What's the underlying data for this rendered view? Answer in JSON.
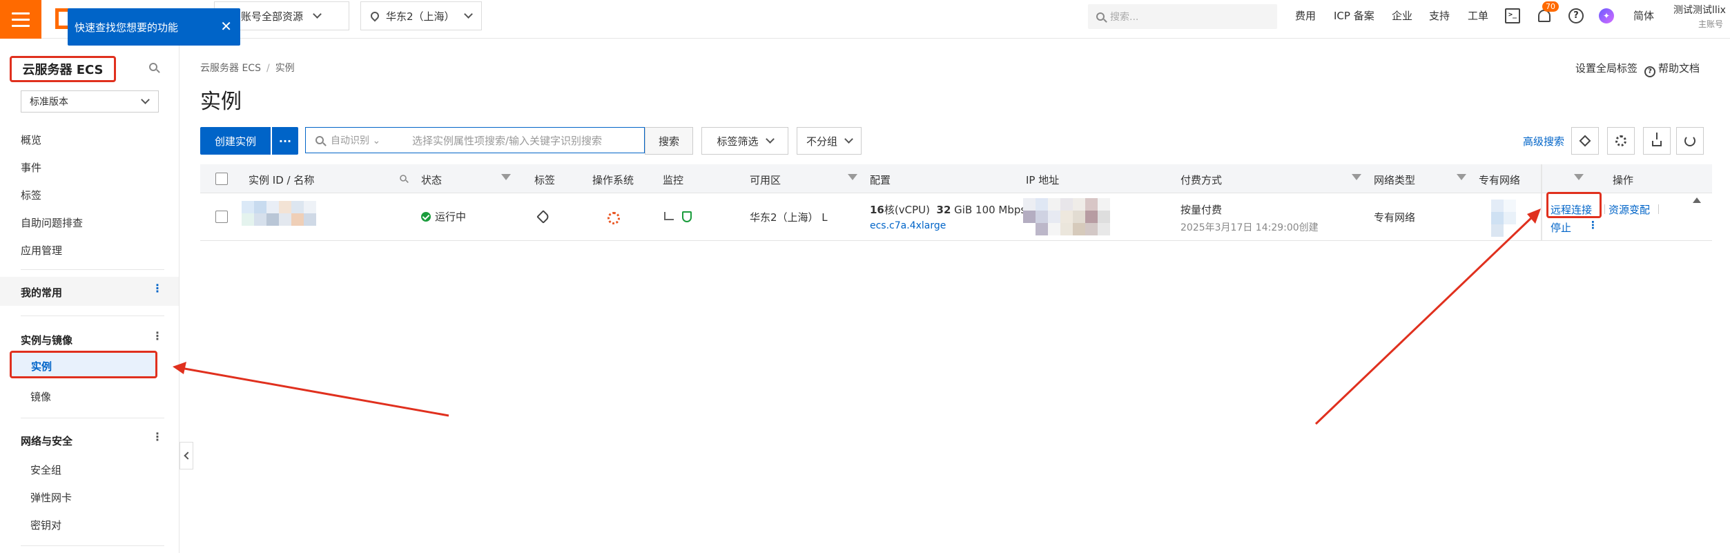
{
  "topbar": {
    "tooltip": "快速查找您想要的功能",
    "tooltip_close": "✕",
    "resource_select": "账号全部资源",
    "region_select": "华东2（上海）",
    "search_placeholder": "搜索...",
    "nav": [
      "费用",
      "ICP 备案",
      "企业",
      "支持",
      "工单"
    ],
    "notification_count": "70",
    "language": "简体",
    "user_name": "测试测试llix",
    "user_role": "主账号"
  },
  "sidebar": {
    "product_title": "云服务器 ECS",
    "version": "标准版本",
    "items": [
      "概览",
      "事件",
      "标签",
      "自助问题排查",
      "应用管理"
    ],
    "favorites": "我的常用",
    "group_instances": {
      "label": "实例与镜像",
      "items": [
        "实例",
        "镜像"
      ]
    },
    "group_network": {
      "label": "网络与安全",
      "items": [
        "安全组",
        "弹性网卡",
        "密钥对"
      ]
    }
  },
  "main": {
    "breadcrumb": [
      "云服务器 ECS",
      "实例"
    ],
    "title": "实例",
    "set_global_tags": "设置全局标签",
    "help_docs": "帮助文档",
    "toolbar": {
      "create": "创建实例",
      "more": "···",
      "search_mode": "自动识别",
      "search_placeholder": "选择实例属性项搜索/输入关键字识别搜索",
      "search_button": "搜索",
      "tag_filter": "标签筛选",
      "group": "不分组",
      "advanced_search": "高级搜索"
    },
    "table": {
      "columns": [
        "实例 ID / 名称",
        "状态",
        "标签",
        "操作系统",
        "监控",
        "可用区",
        "配置",
        "IP 地址",
        "付费方式",
        "网络类型",
        "专有网络",
        "操作"
      ],
      "row": {
        "status": "运行中",
        "zone": "华东2（上海） L",
        "config_cpu_num": "16",
        "config_cpu_unit": "核(vCPU)",
        "config_mem_num": "32",
        "config_mem_rest": "GiB 100 Mbps",
        "instance_type": "ecs.c7a.4xlarge",
        "billing": "按量付费",
        "created": "2025年3月17日 14:29:00创建",
        "network_type": "专有网络",
        "actions": [
          "远程连接",
          "资源变配",
          "停止"
        ],
        "more": "⋮"
      }
    }
  },
  "colors": {
    "brand": "#ff6a00",
    "primary": "#0064c8",
    "highlight_red": "#e0301e",
    "running_green": "#1a9c3c"
  },
  "icons": [
    "menu-icon",
    "resource-icon",
    "location-pin-icon",
    "search-icon",
    "terminal-icon",
    "bell-icon",
    "help-icon",
    "avatar-icon",
    "tag-icon",
    "ubuntu-icon",
    "chart-icon",
    "shield-check-icon",
    "layers-icon",
    "gear-icon",
    "download-icon",
    "refresh-icon"
  ]
}
